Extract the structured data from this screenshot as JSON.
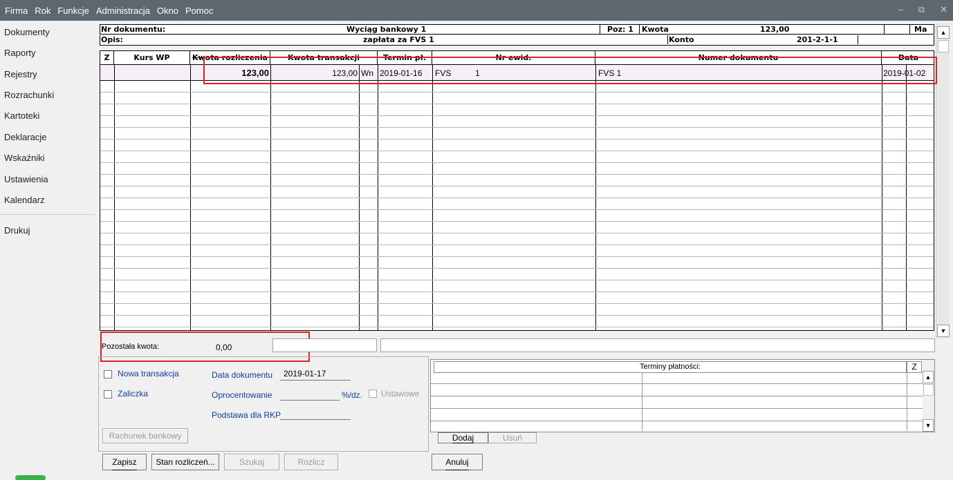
{
  "menu": [
    "Firma",
    "Rok",
    "Funkcje",
    "Administracja",
    "Okno",
    "Pomoc"
  ],
  "sidebar": {
    "items": [
      "Dokumenty",
      "Raporty",
      "Rejestry",
      "Rozrachunki",
      "Kartoteki",
      "Deklaracje",
      "Wskaźniki",
      "Ustawienia",
      "Kalendarz"
    ],
    "print": "Drukuj"
  },
  "header": {
    "nr_label": "Nr dokumentu:",
    "nr_value": "Wyciąg bankowy 1",
    "poz": "Poz: 1",
    "kwota_label": "Kwota",
    "kwota_value": "123,00",
    "ma": "Ma",
    "opis_label": "Opis:",
    "opis_value": "zapłata za FVS 1",
    "konto_label": "Konto",
    "konto_value": "201-2-1-1"
  },
  "columns": [
    "Z",
    "Kurs WP",
    "Kwota rozliczenia",
    "Kwota transakcji",
    "Termin pł.",
    "Nr ewid.",
    "Numer dokumentu",
    "Data"
  ],
  "row": {
    "kwota_rozl": "123,00",
    "kwota_trans": "123,00",
    "wn": "Wn",
    "termin": "2019-01-16",
    "nr_ewid_a": "FVS",
    "nr_ewid_b": "1",
    "numer_dok": "FVS 1",
    "data": "2019-01-02"
  },
  "pozostala": {
    "label": "Pozostała kwota:",
    "value": "0,00"
  },
  "form": {
    "nowa_transakcja": "Nowa transakcja",
    "zaliczka": "Zaliczka",
    "data_dok_label": "Data dokumentu",
    "data_dok_value": "2019-01-17",
    "oprocentowanie_label": "Oprocentowanie",
    "oprocentowanie_unit": "%/dz.",
    "ustawowe": "Ustawowe",
    "podstawa_label": "Podstawa dla RKP",
    "rachunek_btn": "Rachunek bankowy"
  },
  "terminy": {
    "title": "Terminy płatności:",
    "z": "Z",
    "dodaj": "Dodaj",
    "usun": "Usuń"
  },
  "buttons": {
    "zapisz": "Zapisz",
    "stan": "Stan rozliczeń...",
    "szukaj": "Szukaj",
    "rozlicz": "Rozlicz",
    "anuluj": "Anuluj"
  },
  "accent": "#e02020"
}
